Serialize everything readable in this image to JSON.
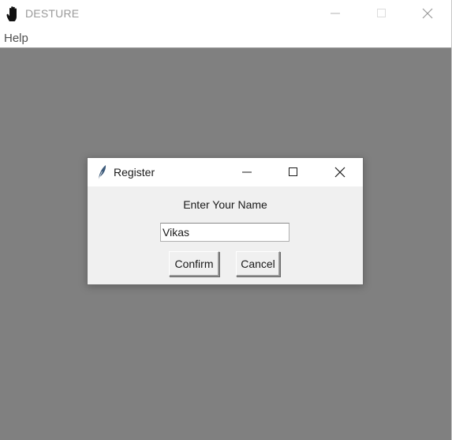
{
  "window": {
    "title": "DESTURE",
    "icon": "hand-icon",
    "controls": [
      "minimize-icon",
      "maximize-icon",
      "close-icon"
    ]
  },
  "menubar": {
    "items": [
      {
        "label": "Help"
      }
    ]
  },
  "dialog": {
    "title": "Register",
    "icon": "feather-icon",
    "prompt": "Enter Your Name",
    "name_value": "Vikas",
    "confirm_label": "Confirm",
    "cancel_label": "Cancel"
  },
  "colors": {
    "client_background": "#808080",
    "dialog_background": "#f0f0f0",
    "titlebar_background": "#ffffff",
    "disabled_title_text": "#9a9a9a"
  }
}
